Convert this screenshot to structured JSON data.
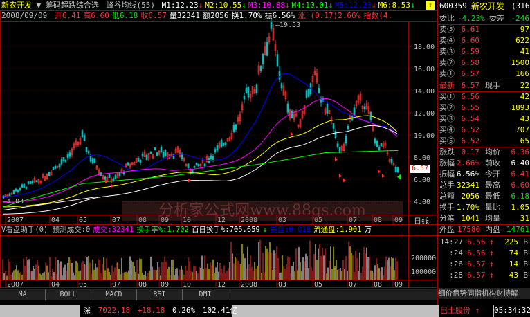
{
  "header": {
    "stock_name": "新农开发",
    "indicator_name": "筹码超跌综合选",
    "indicator2": "峰谷均线(55)",
    "ma": [
      {
        "label": "M1:12.23",
        "color": "#ffffff"
      },
      {
        "label": "M2:10.55",
        "color": "#ffff00"
      },
      {
        "label": "M3:10.88",
        "color": "#ff00ff"
      },
      {
        "label": "M4:10.01",
        "color": "#00ff00"
      },
      {
        "label": "M5:12.23",
        "color": "#0000ff"
      },
      {
        "label": "M6:8.53",
        "color": "#ffff00"
      }
    ],
    "date": "2008/09/09",
    "ohlc": [
      {
        "label": "开6.41",
        "color": "#ff3232"
      },
      {
        "label": "高6.60",
        "color": "#ff3232"
      },
      {
        "label": "低6.18",
        "color": "#00e600"
      },
      {
        "label": "收6.57",
        "color": "#ff3232"
      },
      {
        "label": "量32341",
        "color": "#ffffff"
      },
      {
        "label": "额2056",
        "color": "#ffffff"
      },
      {
        "label": "换1.70%",
        "color": "#ffffff"
      },
      {
        "label": "振6.56%",
        "color": "#ffffff"
      },
      {
        "label": "涨 (0.17)2.66%",
        "color": "#ff3232"
      },
      {
        "label": "指数(4.",
        "color": "#ff3232"
      }
    ]
  },
  "price_chart": {
    "peak_label": "19.53",
    "low_label": "4.03",
    "current_label": "6.57",
    "y_ticks": [
      "18.00",
      "16.00",
      "14.00",
      "12.00",
      "10.00",
      "8.00",
      "6.00",
      "4.00"
    ],
    "x_ticks": [
      "2007",
      "04",
      "05",
      "07",
      "08",
      "09",
      "10",
      "12",
      "2008",
      "03",
      "05",
      "07",
      "08",
      "09"
    ],
    "x_axis_unit": "日线",
    "watermark": "分析家公式网www.88gs.com"
  },
  "volume_chart": {
    "title_items": [
      {
        "label": "V看盘助手(0) 预测成交:0",
        "color": "#c0c0c0"
      },
      {
        "label": "成交:32341",
        "color": "#ff00ff"
      },
      {
        "label": "换手率%:1.702",
        "color": "#00ff00"
      },
      {
        "label": "百日换手%:705.659",
        "color": "#ffffff"
      },
      {
        "label": "↓",
        "color": "#00ff00"
      },
      {
        "label": "贷盘:0.018",
        "color": "#0000ff"
      },
      {
        "label": "流通盘:1.901",
        "color": "#ffff00"
      },
      {
        "label": "万",
        "color": "#ffffff"
      }
    ],
    "y_ticks": [
      "200000",
      "100000"
    ],
    "x_ticks": [
      "2007",
      "04",
      "05",
      "07",
      "08",
      "09",
      "10",
      "12",
      "2008",
      "03",
      "05",
      "07",
      "08",
      "09"
    ]
  },
  "tabs": [
    "MA",
    "BOLL",
    "MACD",
    "RSI",
    "DMI"
  ],
  "quote": {
    "code": "600359",
    "name": "新农开发",
    "extra": "(316",
    "weibi_label": "委比",
    "weibi_value": "-4.23%",
    "weicha_label": "委差",
    "weicha_value": "-246",
    "asks": [
      {
        "label": "卖⑤",
        "price": "6.61",
        "vol": "97"
      },
      {
        "label": "卖④",
        "price": "6.60",
        "vol": "622"
      },
      {
        "label": "卖③",
        "price": "6.59",
        "vol": "41"
      },
      {
        "label": "卖②",
        "price": "6.58",
        "vol": "1500"
      },
      {
        "label": "卖①",
        "price": "6.57",
        "vol": "166"
      }
    ],
    "last_label": "最新",
    "last_price": "6.57",
    "cur_vol_label": "现手",
    "cur_vol": "22",
    "bids": [
      {
        "label": "买①",
        "price": "6.56",
        "vol": "42"
      },
      {
        "label": "买②",
        "price": "6.55",
        "vol": "1893"
      },
      {
        "label": "买③",
        "price": "6.54",
        "vol": "43"
      },
      {
        "label": "买④",
        "price": "6.52",
        "vol": "707"
      },
      {
        "label": "买⑤",
        "price": "6.52",
        "vol": "65"
      }
    ],
    "stats": [
      {
        "l1": "涨跌",
        "v1": "0.17",
        "c1": "#ff3232",
        "l2": "均价",
        "v2": "6.36",
        "c2": "#ff3232"
      },
      {
        "l1": "涨幅",
        "v1": "2.66%",
        "c1": "#ff3232",
        "l2": "前收",
        "v2": "6.40",
        "c2": "#ffffff"
      },
      {
        "l1": "振幅",
        "v1": "6.56%",
        "c1": "#ffffff",
        "l2": "今开",
        "v2": "6.41",
        "c2": "#ff3232"
      },
      {
        "l1": "总手",
        "v1": "32341",
        "c1": "#ffff00",
        "l2": "最高",
        "v2": "6.60",
        "c2": "#ff3232"
      },
      {
        "l1": "总额",
        "v1": "2056",
        "c1": "#ffff00",
        "l2": "最低",
        "v2": "6.18",
        "c2": "#00e600"
      },
      {
        "l1": "换手",
        "v1": "1.70%",
        "c1": "#ffff00",
        "l2": "量比",
        "v2": "1.05",
        "c2": "#ffff00"
      },
      {
        "l1": "分笔",
        "v1": "1041",
        "c1": "#ffff00",
        "l2": "均量",
        "v2": "31",
        "c2": "#ffff00"
      }
    ],
    "outer_label": "外盘",
    "outer_value": "17580",
    "inner_label": "内盘",
    "inner_value": "14761",
    "ticks": [
      {
        "time": "14:27",
        "price": "6.56",
        "arrow": "↑",
        "vol": "225",
        "side": "B"
      },
      {
        "time": ":24",
        "price": "6.56",
        "arrow": "↑",
        "vol": "74",
        "side": "B"
      },
      {
        "time": ":26",
        "price": "6.57",
        "arrow": "↑",
        "vol": "14",
        "side": "B"
      },
      {
        "time": ":28",
        "price": "6.57",
        "arrow": "↑",
        "vol": "43",
        "side": "B"
      }
    ],
    "bottom_tabs": "细价盘势同指机构财持解"
  },
  "status_bar": {
    "market": "深",
    "index_value": "7022.18",
    "index_change": "+18.18",
    "index_pct": "0.26%",
    "turnover": "102.41亿",
    "ticker_name": "巴士股份",
    "ticker_arrow": "↑",
    "time": "05:34:32"
  },
  "colors": {
    "up": "#ff3232",
    "down": "#00e600",
    "axis": "#a00000",
    "ma_white": "#ffffff",
    "ma_yellow": "#ffff00",
    "ma_magenta": "#ff00ff",
    "ma_green": "#00ff00",
    "ma_blue": "#0000ff"
  }
}
